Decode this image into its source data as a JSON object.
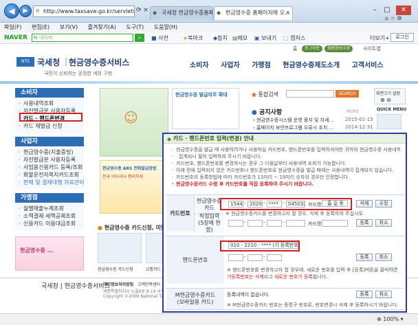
{
  "browser": {
    "url": "http://www.taxsave.go.kr/servlets",
    "tabs": [
      {
        "label": "국세청 현금영수증홈페이지 -"
      },
      {
        "label": "현금영수증 홈페이지에 오..."
      }
    ],
    "window_buttons": [
      "–",
      "□",
      "✕"
    ]
  },
  "menu": [
    "파일(F)",
    "편집(E)",
    "보기(V)",
    "즐겨찾기(A)",
    "도구(T)",
    "도움말(H)"
  ],
  "naver": {
    "brand": "NAVER",
    "placeholder": "네이버",
    "items": [
      "사전",
      "북마크",
      "참치",
      "메모",
      "보내기",
      "캡처스"
    ],
    "more": "더보기+",
    "login": "로그인"
  },
  "site": {
    "top_links": [
      "홈",
      "로그아웃",
      "회원정보수정",
      "사이트맵"
    ],
    "org": "국세청",
    "service": "현금영수증서비스",
    "slogan": "국민이 신뢰하는 공정한 세정 구현",
    "gnb": [
      "소비자",
      "사업자",
      "가맹점",
      "현금영수증제도소개",
      "고객서비스"
    ]
  },
  "lnb": {
    "sections": [
      {
        "title": "소비자",
        "items": [
          "사용내역조회",
          "자진발급분 사용자등록",
          "카드 · 핸드폰변경",
          "카드 재발급 신청"
        ]
      },
      {
        "title": "사업자",
        "items": [
          "현금영수증(지출증빙)",
          "자진발급분 사용자등록",
          "사업용신용카드 등록/조회",
          "화물운전자복지카드조회",
          "판매 및 결제대행 자료관리"
        ]
      },
      {
        "title": "가맹점",
        "items": [
          "월별매출누계조회",
          "소액결제 세액공제조회",
          "신용카드 이용대금조회"
        ]
      }
    ]
  },
  "banners": {
    "main_title": "현금영수증 발급의무 확대",
    "arsmsg": "현금영수증 ARS 전화발급방법",
    "callmsg": "전국 어디서나 편리하게",
    "sub": "현금영수증 카드신청, 미발급",
    "thumbs": [
      "현금영수증 카드신청",
      "교통카드 ..."
    ],
    "promo": "현금영수증 ..."
  },
  "right": {
    "search_label": "통합검색",
    "search_btn": "SEARCH",
    "notice_title": "공지사항",
    "more": "MORE",
    "notices": [
      {
        "text": "현금영수증시스템 운영 중지 및 차세...",
        "date": "2015-01-15"
      },
      {
        "text": "홈페이지 보안프로그램 오류시 조치 ...",
        "date": "2014-12-31"
      }
    ],
    "quick_label": "화면크기 설정",
    "quick_menu": "QUICK MENU"
  },
  "popup": {
    "title": "카드 · 핸드폰번호 입력(변경) 안내",
    "notes": [
      "현금영수증을 발급 때 사용하려거나 사용하실 카드번호, 핸드폰번호를 입력하셔야만 귀하의 현금영수증 사용내역이",
      "집계되니 필히 입력하여 주시기 바랍니다.",
      "카드번호, 핸드폰번호를 변경하시는 경우 그 다음날부터 사용내역 조회가 가능합니다.",
      "아래 란에 입력되지 않은 카드번호나 핸드폰번호로 현금영수증을 발급 때에는 사용내역이 집계되지 않습니다.",
      "카드번호의 등록방법에 따라 카드번호가 13자리 ~ 19자리 숫자의 경우만 인정합니다."
    ],
    "red_note": "현금영수증카드 수령 후 카드번호를 직접 등록하여 주시기 바랍니다.",
    "card_section": "카드번호",
    "card_label": "현금영수증 카드",
    "card_parts": [
      "1544",
      "2020",
      "****",
      "045032"
    ],
    "card_type": "카드명",
    "card_name": "홈 길 동",
    "btn_delete": "삭제",
    "btn_modify": "수정",
    "card_note": "※ 현금영수증카드를 변경하고자 할 경우, 삭제 후 등록하여 주십시오.",
    "direct_label": "직접입력",
    "direct_sub": "(5장에 한함)",
    "direct_type": "카드명",
    "btn_register": "등록",
    "btn_cancel": "취소",
    "phone_label": "핸드폰번호",
    "phone_value": "010 - 2210 - **** (기 등록번호)",
    "phone_note1": "※ 핸드폰번호를 변경하고자 할 경우에, 새로운 번호를 입력 후 [등록]버튼을 클릭하면",
    "phone_note2a": "기등록번호는 삭제",
    "phone_note2b": "되고 ",
    "phone_note2c": "새로운 번호가 등록",
    "phone_note2d": "됩니다.",
    "membership_label": "M현금영수증카드",
    "membership_sub": "(모바일용 카드)",
    "membership_status": "등록내역이 없습니다.",
    "membership_note": "※ M현금영수증카드 번호는 증명구 번호로, 번호변경시 삭제 후 등록하시기 바랍니다."
  },
  "footer": {
    "logo": "국세청 | 현금영수증서비스",
    "links": [
      "개인정보처리방침",
      "고객만족센터"
    ],
    "copy1": "세종특별자치시 노을6로 8-14 국세청",
    "copy2": "Copyright ©2009 National Tax Se..."
  },
  "status": {
    "zoom": "100%"
  }
}
